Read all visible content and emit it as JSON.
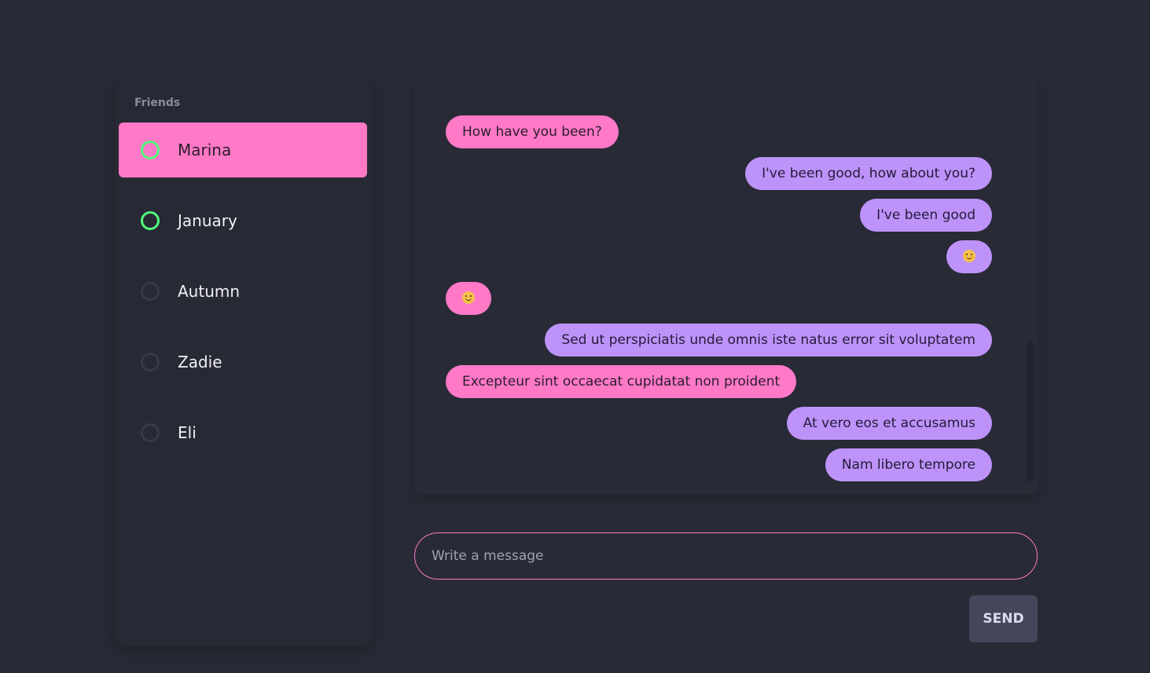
{
  "sidebar": {
    "title": "Friends",
    "friends": [
      {
        "name": "Marina",
        "online": true,
        "active": true
      },
      {
        "name": "January",
        "online": true,
        "active": false
      },
      {
        "name": "Autumn",
        "online": false,
        "active": false
      },
      {
        "name": "Zadie",
        "online": false,
        "active": false
      },
      {
        "name": "Eli",
        "online": false,
        "active": false
      }
    ]
  },
  "chat": {
    "messages": [
      {
        "direction": "incoming",
        "text": "How have you been?"
      },
      {
        "direction": "outgoing",
        "text": "I've been good, how about you?"
      },
      {
        "direction": "outgoing",
        "text": "I've been good"
      },
      {
        "direction": "outgoing",
        "text": "",
        "icon": "smiley-icon"
      },
      {
        "direction": "incoming",
        "text": "",
        "icon": "smiley-icon"
      },
      {
        "direction": "outgoing",
        "text": "Sed ut perspiciatis unde omnis iste natus error sit voluptatem"
      },
      {
        "direction": "incoming",
        "text": "Excepteur sint occaecat cupidatat non proident"
      },
      {
        "direction": "outgoing",
        "text": "At vero eos et accusamus"
      },
      {
        "direction": "outgoing",
        "text": "Nam libero tempore"
      }
    ]
  },
  "composer": {
    "placeholder": "Write a message",
    "value": "",
    "send_label": "SEND"
  },
  "colors": {
    "background": "#282a36",
    "incoming_bubble": "#ff79c6",
    "outgoing_bubble": "#bd93f9",
    "online_status": "#50fa7b",
    "send_button": "#44475a"
  }
}
